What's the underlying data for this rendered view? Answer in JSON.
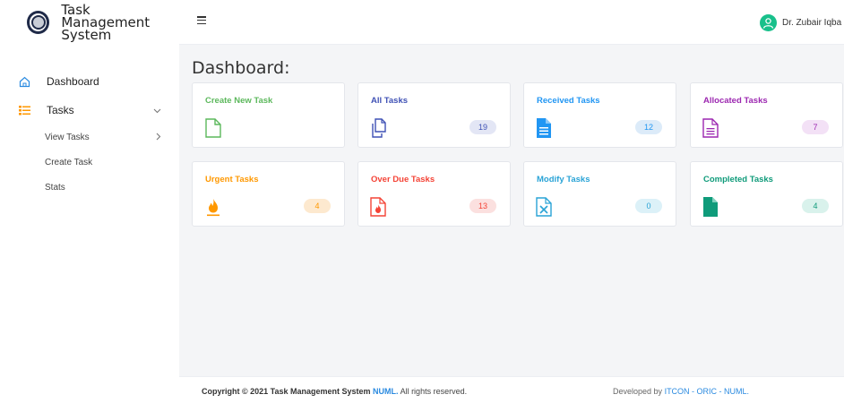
{
  "brand": {
    "title_line1": "Task Management",
    "title_line2": "System"
  },
  "sidebar": {
    "items": [
      {
        "label": "Dashboard",
        "icon": "home-icon"
      },
      {
        "label": "Tasks",
        "icon": "list-icon"
      }
    ],
    "sub_items": [
      {
        "label": "View Tasks"
      },
      {
        "label": "Create Task"
      },
      {
        "label": "Stats"
      }
    ]
  },
  "header": {
    "user_name": "Dr. Zubair Iqba"
  },
  "main": {
    "title": "Dashboard:"
  },
  "cards": [
    {
      "title": "Create New Task",
      "count": null,
      "color": "#5cb85c",
      "icon": "file-icon"
    },
    {
      "title": "All Tasks",
      "count": "19",
      "color": "#3f51b5",
      "icon": "copy-icon"
    },
    {
      "title": "Received Tasks",
      "count": "12",
      "color": "#2196f3",
      "icon": "document-icon"
    },
    {
      "title": "Allocated Tasks",
      "count": "7",
      "color": "#9c27b0",
      "icon": "document-lines-icon"
    },
    {
      "title": "Urgent Tasks",
      "count": "4",
      "color": "#ff9800",
      "icon": "fire-icon"
    },
    {
      "title": "Over Due Tasks",
      "count": "13",
      "color": "#f44336",
      "icon": "file-fire-icon"
    },
    {
      "title": "Modify Tasks",
      "count": "0",
      "color": "#29a3d6",
      "icon": "excel-file-icon"
    },
    {
      "title": "Completed Tasks",
      "count": "4",
      "color": "#0f9b7a",
      "icon": "file-filled-icon"
    }
  ],
  "footer": {
    "copyright": "Copyright © 2021 Task Management System",
    "brand": "NUML.",
    "rights": "All rights reserved.",
    "developed_by": "Developed by",
    "dev_links": "ITCON - ORIC - NUML."
  }
}
